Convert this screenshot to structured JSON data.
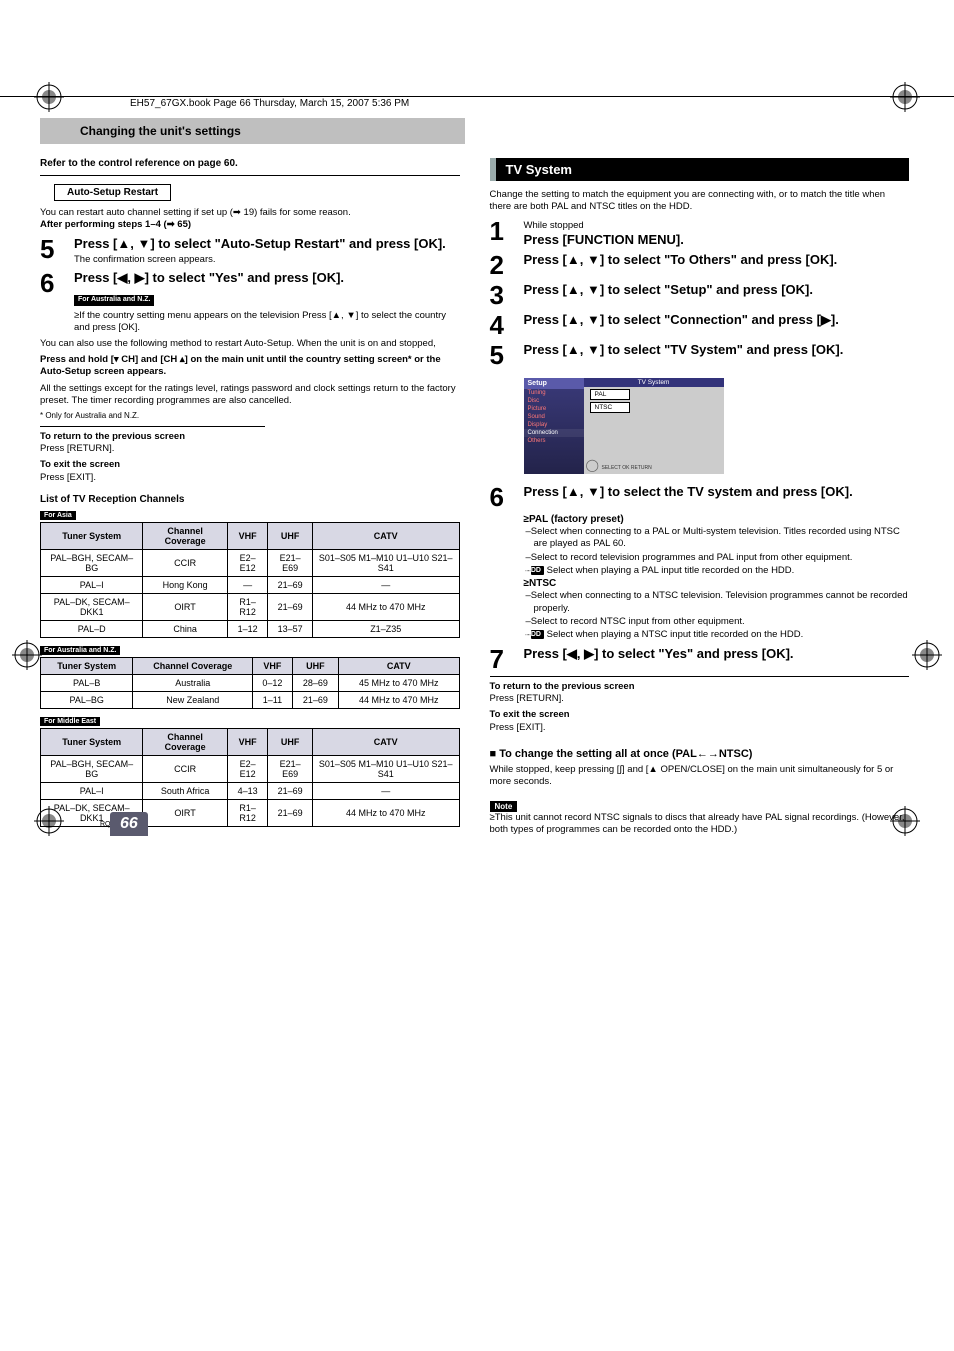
{
  "file_info": "EH57_67GX.book  Page 66  Thursday, March 15, 2007  5:36 PM",
  "title_bar": "Changing the unit's settings",
  "ref_line": "Refer to the control reference on page 60.",
  "auto_setup_label": "Auto-Setup Restart",
  "intro1": "You can restart auto channel setting if set up (➡ 19) fails for some reason.",
  "after_steps": "After performing steps 1–4 (➡ 65)",
  "step5_body": "Press [▲, ▼] to select \"Auto-Setup Restart\" and press [OK].",
  "step5_sub": "The confirmation screen appears.",
  "step6_body": "Press [◀, ▶] to select \"Yes\" and press [OK].",
  "region_aus": "For Australia and N.Z.",
  "step6_sub1": "≥If the country setting menu appears on the television Press [▲, ▼] to select the country and press [OK].",
  "para_restart": "You can also use the following method to restart Auto-Setup. When the unit is on and stopped,",
  "para_hold": "Press and hold [▾ CH] and [CH ▴] on the main unit until the country setting screen* or the Auto-Setup screen appears.",
  "para_reset": "All the settings except for the ratings level, ratings password and clock settings return to the factory preset. The timer recording programmes are also cancelled.",
  "foot_only": "* Only for Australia and N.Z.",
  "return_heading": "To return to the previous screen",
  "return_body": "Press [RETURN].",
  "exit_heading": "To exit the screen",
  "exit_body": "Press [EXIT].",
  "list_heading": "List of TV Reception Channels",
  "region_asia": "For Asia",
  "region_me": "For Middle East",
  "table_headers": [
    "Tuner System",
    "Channel Coverage",
    "VHF",
    "UHF",
    "CATV"
  ],
  "table_asia": [
    [
      "PAL–BGH, SECAM–BG",
      "CCIR",
      "E2–E12",
      "E21–E69",
      "S01–S05 M1–M10 U1–U10 S21–S41"
    ],
    [
      "PAL–I",
      "Hong Kong",
      "—",
      "21–69",
      "—"
    ],
    [
      "PAL–DK, SECAM–DKK1",
      "OIRT",
      "R1–R12",
      "21–69",
      "44 MHz to 470 MHz"
    ],
    [
      "PAL–D",
      "China",
      "1–12",
      "13–57",
      "Z1–Z35"
    ]
  ],
  "table_aus": [
    [
      "PAL–B",
      "Australia",
      "0–12",
      "28–69",
      "45 MHz to 470 MHz"
    ],
    [
      "PAL–BG",
      "New Zealand",
      "1–11",
      "21–69",
      "44 MHz to 470 MHz"
    ]
  ],
  "table_me": [
    [
      "PAL–BGH, SECAM–BG",
      "CCIR",
      "E2–E12",
      "E21–E69",
      "S01–S05 M1–M10 U1–U10 S21–S41"
    ],
    [
      "PAL–I",
      "South Africa",
      "4–13",
      "21–69",
      "—"
    ],
    [
      "PAL–DK, SECAM–DKK1",
      "OIRT",
      "R1–R12",
      "21–69",
      "44 MHz to 470 MHz"
    ]
  ],
  "tv_system_title": "TV System",
  "tv_intro": "Change the setting to match the equipment you are connecting with, or to match the title when there are both PAL and NTSC titles on the HDD.",
  "rstep1a": "While stopped",
  "rstep1b": "Press [FUNCTION MENU].",
  "rstep2": "Press [▲, ▼] to select \"To Others\" and press [OK].",
  "rstep3": "Press [▲, ▼] to select \"Setup\" and press [OK].",
  "rstep4": "Press [▲, ▼] to select \"Connection\" and press [▶].",
  "rstep5": "Press [▲, ▼] to select \"TV System\" and press [OK].",
  "rstep6": "Press [▲, ▼] to select the TV system and press [OK].",
  "pal_label": "≥PAL (factory preset)",
  "pal_b1": "–Select when connecting to a PAL or Multi-system television. Titles recorded using NTSC are played as PAL 60.",
  "pal_b2": "–Select to record television programmes and PAL input from other equipment.",
  "pal_b3a": "–",
  "pal_b3b": " Select when playing a PAL input title recorded on the HDD.",
  "ntsc_label": "≥NTSC",
  "ntsc_b1": "–Select when connecting to a NTSC television. Television programmes cannot be recorded properly.",
  "ntsc_b2": "–Select to record NTSC input from other equipment.",
  "ntsc_b3a": "–",
  "ntsc_b3b": " Select when playing a NTSC input title recorded on the HDD.",
  "hdd_tag": "HDD",
  "rstep7": "Press [◀, ▶] to select \"Yes\" and press [OK].",
  "change_all": "■ To change the setting all at once (PAL←→NTSC)",
  "change_all_body": "While stopped, keep pressing [∫] and [▲ OPEN/CLOSE] on the main unit simultaneously for 5 or more seconds.",
  "note_label": "Note",
  "note_body": "≥This unit cannot record NTSC signals to discs that already have PAL signal recordings. (However, both types of programmes can be recorded onto the HDD.)",
  "page_num": "66",
  "rqt": "RQT8906",
  "setup_illust": {
    "sidebar_title": "Setup",
    "sidebar_items": [
      "Tuning",
      "Disc",
      "Picture",
      "Sound",
      "Display",
      "Connection",
      "Others"
    ],
    "main_bar": "TV System",
    "opt1": "PAL",
    "opt2": "NTSC",
    "remote_label": "SELECT",
    "remote_ok": "OK",
    "remote_return": "RETURN"
  }
}
